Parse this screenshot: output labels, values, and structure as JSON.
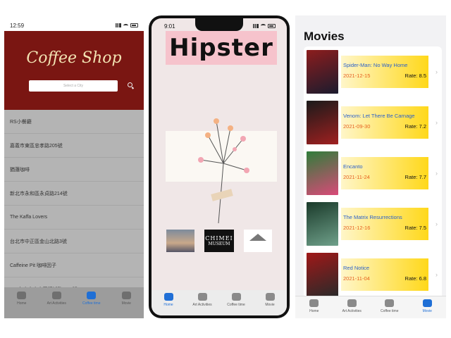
{
  "coffee": {
    "time": "12:59",
    "title": "Coffee Shop",
    "search_placeholder": "Select a City",
    "items": [
      "RS小餐廳",
      "嘉義市東區忠孝路205號",
      "猶蓮咖啡",
      "新北市永和區永貞路214號",
      "The Kaffa Lovers",
      "台北市中正區金山北路3號",
      "Caffeine Pit 咖啡因子",
      "408台中市南屯區精誠路55-1號"
    ],
    "tabs": [
      "Home",
      "Art Activities",
      "Coffee time",
      "Movie"
    ]
  },
  "hipster": {
    "time": "9:01",
    "banner": "Hipster",
    "logo_chimei_line1": "CHIMEI",
    "logo_chimei_line2": "MUSEUM",
    "tabs": [
      "Home",
      "Art Activities",
      "Coffee time",
      "Movie"
    ]
  },
  "movies": {
    "title": "Movies",
    "rate_prefix": "Rate: ",
    "list": [
      {
        "title": "Spider-Man: No Way Home",
        "date": "2021-12-15",
        "rate": "8.5",
        "colors": [
          "#8c1d1d",
          "#1b1b2e"
        ]
      },
      {
        "title": "Venom: Let There Be Carnage",
        "date": "2021-09-30",
        "rate": "7.2",
        "colors": [
          "#1a1a1a",
          "#a02020"
        ]
      },
      {
        "title": "Encanto",
        "date": "2021-11-24",
        "rate": "7.7",
        "colors": [
          "#2f7d3a",
          "#d94a78"
        ]
      },
      {
        "title": "The Matrix Resurrections",
        "date": "2021-12-16",
        "rate": "7.5",
        "colors": [
          "#1a3a2a",
          "#6fa08a"
        ]
      },
      {
        "title": "Red Notice",
        "date": "2021-11-04",
        "rate": "6.8",
        "colors": [
          "#a01818",
          "#2a2a2a"
        ]
      }
    ],
    "tabs": [
      "Home",
      "Art Activities",
      "Coffee time",
      "Movie"
    ]
  }
}
